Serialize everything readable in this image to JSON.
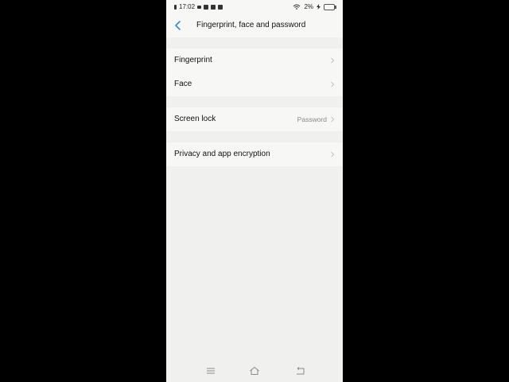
{
  "status_bar": {
    "time": "17:02",
    "battery": "2%"
  },
  "header": {
    "title": "Fingerprint, face and password"
  },
  "sections": [
    {
      "rows": [
        {
          "label": "Fingerprint",
          "value": ""
        },
        {
          "label": "Face",
          "value": ""
        }
      ]
    },
    {
      "rows": [
        {
          "label": "Screen lock",
          "value": "Password"
        }
      ]
    },
    {
      "rows": [
        {
          "label": "Privacy and app encryption",
          "value": ""
        }
      ]
    }
  ],
  "icons": {
    "back": "back-arrow-icon",
    "chevron": "chevron-right-icon",
    "nav_menu": "menu-icon",
    "nav_home": "home-icon",
    "nav_back": "return-icon"
  },
  "colors": {
    "accent": "#3d86d6",
    "background": "#f0f0ee",
    "card": "#f7f7f6"
  }
}
